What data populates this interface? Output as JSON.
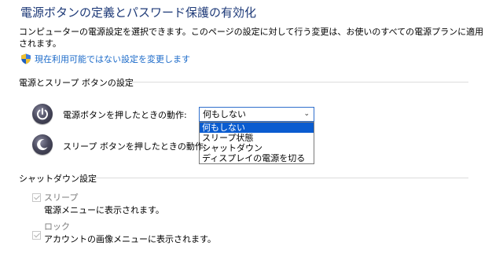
{
  "page": {
    "title": "電源ボタンの定義とパスワード保護の有効化",
    "description": "コンピューターの電源設定を選択できます。このページの設定に対して行う変更は、お使いのすべての電源プランに適用されます。",
    "change_link": "現在利用可能ではない設定を変更します"
  },
  "power_sleep_section": {
    "heading": "電源とスリープ ボタンの設定",
    "power_button": {
      "label": "電源ボタンを押したときの動作:",
      "value": "何もしない",
      "options": [
        "何もしない",
        "スリープ状態",
        "シャットダウン",
        "ディスプレイの電源を切る"
      ],
      "selected_index": 0
    },
    "sleep_button": {
      "label": "スリープ ボタンを押したときの動作:"
    }
  },
  "shutdown_section": {
    "heading": "シャットダウン設定",
    "items": [
      {
        "label": "スリープ",
        "description": "電源メニューに表示されます。",
        "checked": true,
        "enabled": false
      },
      {
        "label": "ロック",
        "description": "アカウントの画像メニューに表示されます。",
        "checked": true,
        "enabled": false
      }
    ]
  },
  "colors": {
    "title": "#1e3a78",
    "link": "#1b6ac9",
    "selection": "#0a5cd0",
    "disabled_text": "#7a7a7a"
  },
  "icons": {
    "link_icon": "uac-shield-icon",
    "power_icon": "power-icon",
    "sleep_icon": "sleep-moon-icon"
  }
}
